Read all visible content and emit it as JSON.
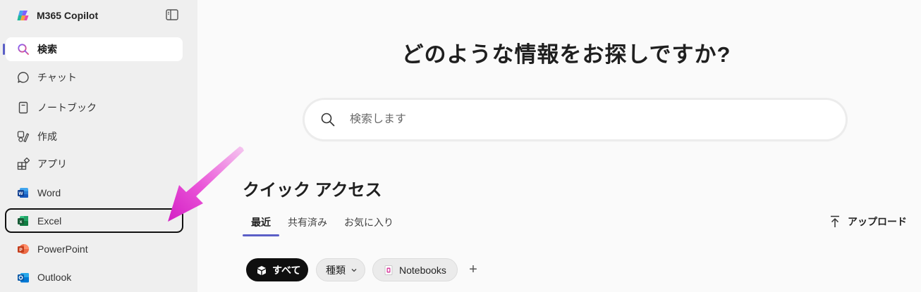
{
  "app": {
    "title": "M365 Copilot"
  },
  "sidebar": {
    "items": [
      {
        "label": "検索",
        "icon": "search-icon"
      },
      {
        "label": "チャット",
        "icon": "chat-icon"
      },
      {
        "label": "ノートブック",
        "icon": "notebook-icon"
      },
      {
        "label": "作成",
        "icon": "create-icon"
      },
      {
        "label": "アプリ",
        "icon": "apps-icon"
      },
      {
        "label": "Word",
        "icon": "word-icon"
      },
      {
        "label": "Excel",
        "icon": "excel-icon"
      },
      {
        "label": "PowerPoint",
        "icon": "powerpoint-icon"
      },
      {
        "label": "Outlook",
        "icon": "outlook-icon"
      }
    ]
  },
  "main": {
    "heading": "どのような情報をお探しですか?",
    "search": {
      "placeholder": "検索します"
    },
    "quick_access": {
      "title": "クイック アクセス",
      "tabs": [
        "最近",
        "共有済み",
        "お気に入り"
      ],
      "upload_label": "アップロード",
      "filters": {
        "all": "すべて",
        "type": "種類",
        "notebooks": "Notebooks",
        "add": "+"
      }
    }
  },
  "colors": {
    "accent": "#5b5fc7",
    "annotation_arrow": "#e020c8",
    "annotation_box": "#111111"
  }
}
